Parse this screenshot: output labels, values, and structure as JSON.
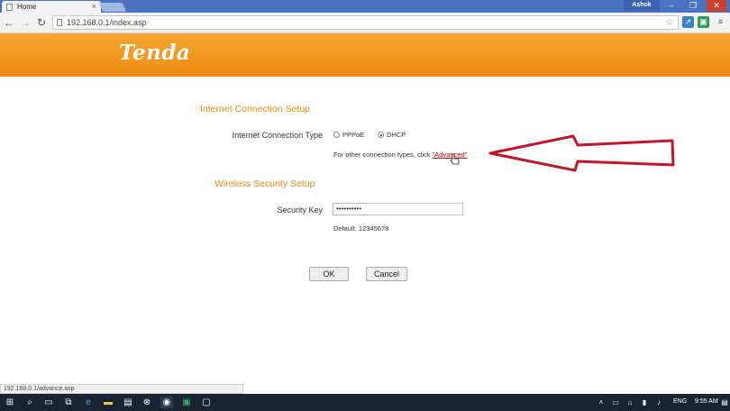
{
  "browser": {
    "tab_title": "Home",
    "tab_close": "×",
    "user_badge": "Ashok",
    "url": "192.168.0.1/index.asp",
    "status_url": "192.168.0.1/advance.asp",
    "window_controls": [
      "–",
      "❐",
      "✕"
    ]
  },
  "header": {
    "logo": "Tenda"
  },
  "internet_setup": {
    "title": "Internet Connection Setup",
    "type_label": "Internet Connection Type",
    "options": [
      "PPPoE",
      "DHCP"
    ],
    "selected": "DHCP",
    "hint_prefix": "For other connection types, click ",
    "hint_link": "\"Advanced\""
  },
  "wireless_setup": {
    "title": "Wireless Security Setup",
    "key_label": "Security Key",
    "key_value": "••••••••••",
    "default_text": "Default: 12345678"
  },
  "buttons": {
    "ok": "OK",
    "cancel": "Cancel"
  },
  "taskbar": {
    "language": "ENG",
    "time": "9:55 AM"
  },
  "colors": {
    "accent_orange": "#ef8a0f",
    "arrow_red": "#c0152a",
    "taskbar": "#1a2330"
  },
  "icons": [
    "windows-start-icon",
    "search-icon",
    "task-view-icon",
    "explorer-icon",
    "edge-icon",
    "folder-icon",
    "store-icon",
    "xbox-icon",
    "chrome-icon",
    "excel-icon",
    "app-icon"
  ]
}
